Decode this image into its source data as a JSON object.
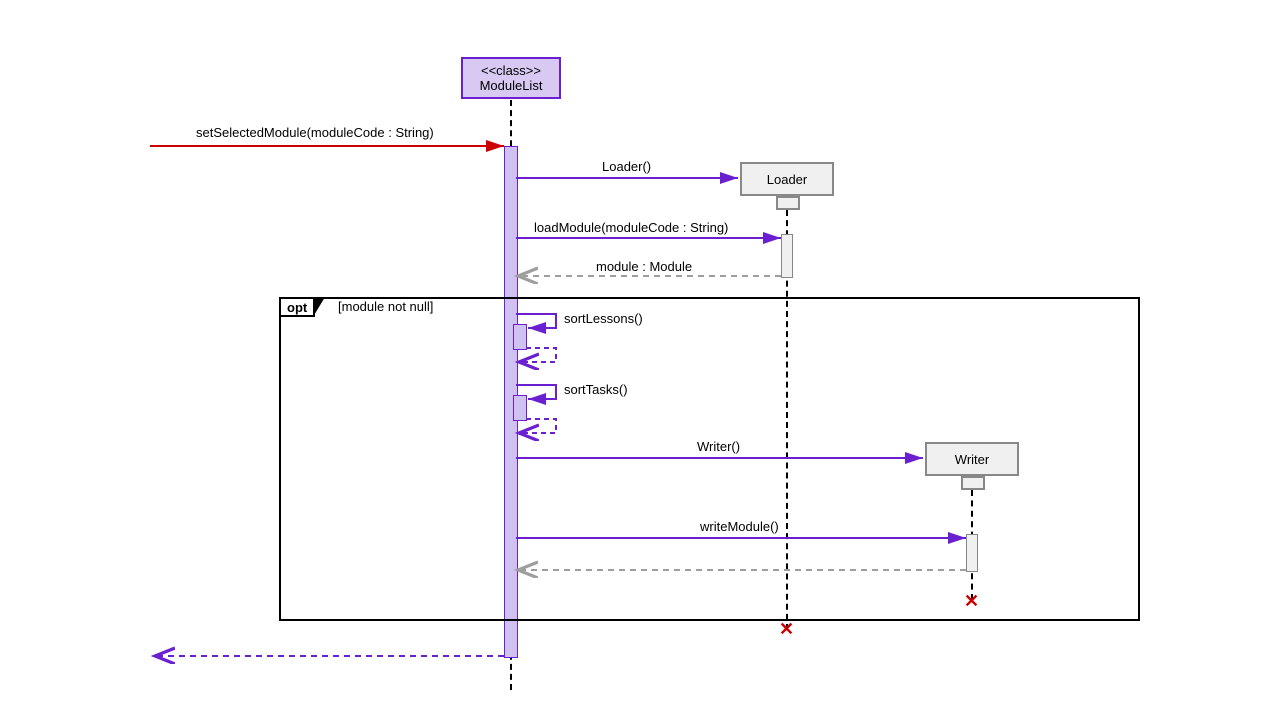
{
  "participants": {
    "moduleList": {
      "stereotype": "<<class>>",
      "name": "ModuleList"
    },
    "loader": {
      "name": "Loader"
    },
    "writer": {
      "name": "Writer"
    }
  },
  "messages": {
    "setSelectedModule": "setSelectedModule(moduleCode : String)",
    "loaderCtor": "Loader()",
    "loadModule": "loadModule(moduleCode : String)",
    "moduleReturn": "module : Module",
    "sortLessons": "sortLessons()",
    "sortTasks": "sortTasks()",
    "writerCtor": "Writer()",
    "writeModule": "writeModule()"
  },
  "frame": {
    "type": "opt",
    "guard": "[module not null]"
  },
  "colors": {
    "purple": "#6a1fd0",
    "lightPurple": "#cfc2f0",
    "grey": "#888",
    "lightGrey": "#f0f0f0",
    "red": "#c00"
  }
}
